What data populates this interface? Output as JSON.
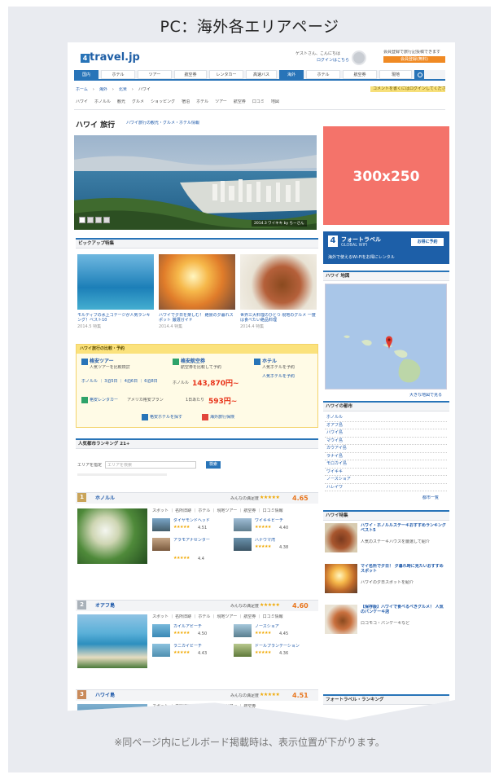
{
  "frame": {
    "title": "PC：海外各エリアページ",
    "footer_note": "※同ページ内にビルボード掲載時は、表示位置が下がります。"
  },
  "header": {
    "logo_mark": "4",
    "logo_text": "travel.jp",
    "greeting": "ゲストさん、こんにちは",
    "login": "ログインはこちら",
    "register_button": "会員登録(無料)",
    "promo": "会員登録で旅行記投稿できます"
  },
  "nav": {
    "items": [
      "国内",
      "ホテル",
      "ツアー",
      "航空券",
      "レンタカー",
      "高速バス",
      "海外",
      "ホテル",
      "航空券",
      "現地"
    ]
  },
  "breadcrumb": [
    "ホーム",
    "海外",
    "北米",
    "ハワイ"
  ],
  "subnav": [
    "ハワイ",
    "ホノルル",
    "観光",
    "グルメ",
    "ショッピング",
    "宿泊",
    "ホテル",
    "ツアー",
    "航空券",
    "口コミ",
    "地図"
  ],
  "bookmark_tag": "コメントを書くにはログインしてください",
  "page_title": "ハワイ 旅行",
  "page_title_note": "ハワイ旅行の観光・グルメ・ホテル情報",
  "hero": {
    "caption": "2014.3 ワイキキ by ちーさん",
    "thumb_count": 4
  },
  "ad": {
    "label": "300x250"
  },
  "pickup": {
    "heading": "ピックアップ特集",
    "items": [
      {
        "title": "モルディブの水上コテージが人気ランキング！ベスト10",
        "meta": "2014.5 特集"
      },
      {
        "title": "ハワイで夕日を楽しむ！ 絶景の夕暮れスポット 厳選ガイド",
        "meta": "2014.4 特集"
      },
      {
        "title": "世界三大料理のひとつ 現地のグルメ 一度は食べたい絶品料理",
        "meta": "2014.4 特集"
      }
    ]
  },
  "compare": {
    "heading": "ハワイ旅行の比較・予約",
    "tour_label": "格安ツアー",
    "tour_desc": "人気ツアーを比較検討",
    "flight_label": "格安航空券",
    "flight_desc": "航空券を比較して予約",
    "hotel_label": "ホテル",
    "hotel_desc": "人気ホテルを予約",
    "tour_links": "ホノルル ｜ 3泊5日 ｜ 4泊6日 ｜ 6泊8日",
    "from_label": "ホノルル",
    "price_flight": "143,870円~",
    "rental_label": "格安レンタカー",
    "rental_desc": "アメリカ格安プラン",
    "from_label2": "1日あたり",
    "price_rental": "593円~",
    "search_btn1": "格安ホテルを探す",
    "search_btn2": "海外旅行保険"
  },
  "ranking": {
    "heading": "人気都市ランキング 21+",
    "input_placeholder": "エリアを検索",
    "search_btn": "検索",
    "rating_label": "みんなの満足度",
    "cities": [
      {
        "rank": "1",
        "name": "ホノルル",
        "rating": "4.65",
        "subtabs": "スポット ｜ 名所旧跡 ｜ ホテル ｜ 現地ツアー ｜ 航空券 ｜ 口コミ情報",
        "spots": [
          {
            "name": "ダイヤモンドヘッド",
            "score": "4.51"
          },
          {
            "name": "ワイキキビーチ",
            "score": "4.40"
          },
          {
            "name": "アラモアナセンター",
            "score": "4.4"
          },
          {
            "name": "ハナウマ湾",
            "score": "4.38"
          }
        ]
      },
      {
        "rank": "2",
        "name": "オアフ島",
        "rating": "4.60",
        "subtabs": "スポット ｜ 名所旧跡 ｜ ホテル ｜ 現地ツアー ｜ 航空券 ｜ 口コミ情報",
        "spots": [
          {
            "name": "カイルアビーチ",
            "score": "4.50"
          },
          {
            "name": "ノースショア",
            "score": "4.45"
          },
          {
            "name": "ラニカイビーチ",
            "score": "4.43"
          },
          {
            "name": "ドールプランテーション",
            "score": "4.36"
          }
        ]
      },
      {
        "rank": "3",
        "name": "ハワイ島",
        "rating": "4.51",
        "subtabs": "スポット ｜ 名所旧跡 ｜ ホテル ｜ 現地ツアー ｜ 航空券",
        "spots": []
      }
    ],
    "stars": "★★★★★"
  },
  "sidebar": {
    "banner_brand": "フォートラベル",
    "banner_sub": "GLOBAL WIFI",
    "banner_cta": "お得に予約",
    "banner_note": "海外で使えるWi-Fiをお得にレンタル",
    "map_heading": "ハワイ 地図",
    "map_link": "大きな地図で見る",
    "areas_heading": "ハワイの都市",
    "areas": [
      "ホノルル",
      "オアフ島",
      "ハワイ島",
      "マウイ島",
      "カウアイ島",
      "ラナイ島",
      "モロカイ島",
      "ワイキキ",
      "ノースショア",
      "ハレイワ"
    ],
    "areas_more": "都市一覧",
    "features_heading": "ハワイ特集",
    "features": [
      {
        "title": "ハワイ・ホノルルステーキおすすめランキングベスト5",
        "desc": "人気のステーキハウスを厳選して紹介"
      },
      {
        "title": "マイ名所で夕日！ 夕暮れ時に見たいおすすめスポット",
        "desc": "ハワイの夕日スポットを紹介"
      },
      {
        "title": "【保存版】ハワイで食べるべきグルメ！ 人気のパンケーキ店",
        "desc": "ロコモコ・パンケーキなど"
      }
    ],
    "ranking_heading": "フォートラベル・ランキング"
  }
}
